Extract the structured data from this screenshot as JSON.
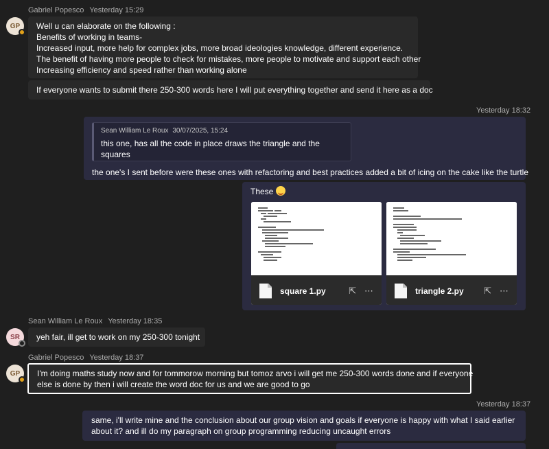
{
  "messages": {
    "m1": {
      "sender": "Gabriel Popesco",
      "time": "Yesterday 15:29",
      "avatar": "GP",
      "lines": [
        "Well u can elaborate on the following :",
        "Benefits of working in teams-",
        "Increased input, more help for complex jobs, more broad ideologies knowledge, different experience.",
        "The benefit of having more people to check for mistakes, more people to motivate and support each other",
        "Increasing efficiency and speed rather than working alone"
      ],
      "followup": "If everyone wants to submit there 250-300 words here I will put everything together and send it here as a doc"
    },
    "m2": {
      "time": "Yesterday 18:32",
      "quote_sender": "Sean William Le Roux",
      "quote_time": "30/07/2025, 15:24",
      "quote_lines": [
        "this one, has all the code in place draws the triangle and the",
        "squares"
      ],
      "text": "the one's I sent before were these ones with refactoring and best practices added a bit of icing on the cake like the turtle"
    },
    "m3": {
      "text": "These",
      "emoji": "grinning-face-emoji",
      "files": [
        {
          "name": "square 1.py"
        },
        {
          "name": "triangle 2.py"
        }
      ]
    },
    "m4": {
      "sender": "Sean William Le Roux",
      "time": "Yesterday 18:35",
      "avatar": "SR",
      "text": "yeh fair, ill get to work on my 250-300 tonight"
    },
    "m5": {
      "sender": "Gabriel Popesco",
      "time": "Yesterday 18:37",
      "avatar": "GP",
      "lines": [
        "I'm doing maths study now and for tommorow morning but tomoz arvo i will get me 250-300 words done and if everyone",
        "else is done by then i will create the word doc for us and we are good to go"
      ]
    },
    "m6": {
      "time": "Yesterday 18:37",
      "lines": [
        "same, i'll write mine and the conclusion about our group vision and goals if everyone is happy with what I said earlier",
        "about it? and ill do my paragraph on group programming reducing uncaught errors"
      ]
    }
  },
  "icons": {
    "share": "share-icon",
    "more": "more-options-icon",
    "file": "python-file-icon"
  },
  "colors": {
    "background": "#1f1f1f",
    "incoming_bubble": "#292929",
    "outgoing_bubble": "#2b2b40",
    "away_status": "#e3a21a"
  }
}
